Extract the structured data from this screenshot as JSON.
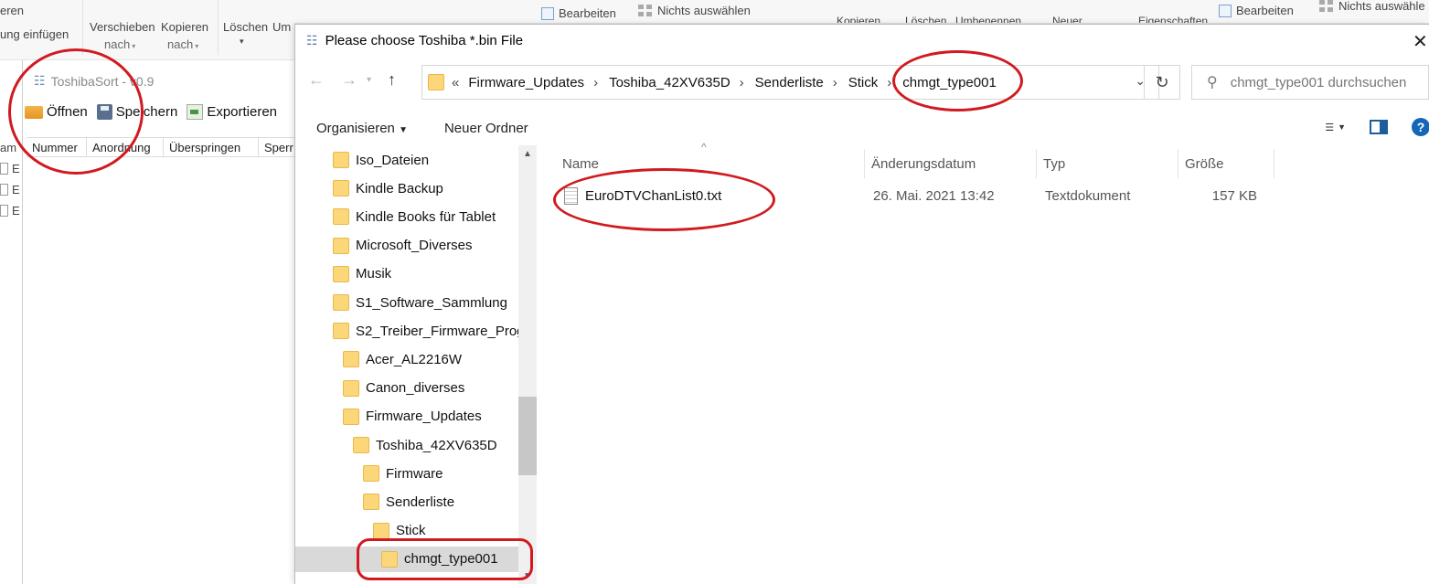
{
  "background_left": {
    "ribbon_texts": [
      "eren",
      "ung einfügen",
      "Verschieben",
      "nach",
      "Kopieren",
      "nach",
      "Löschen",
      "Um"
    ]
  },
  "background_right": {
    "ribbon_texts": [
      "Kopieren",
      "Löschen",
      "Umbenennen",
      "Neuer",
      "Eigenschaften",
      "Bearbeiten",
      "Nichts auswähle"
    ],
    "middle_texts": [
      "Bearbeiten",
      "Nichts auswählen"
    ]
  },
  "app": {
    "title": "ToshibaSort - v0.9",
    "toolbar": {
      "open": "Öffnen",
      "save": "Speichern",
      "export": "Exportieren"
    },
    "columns": [
      "Nummer",
      "Anordnung",
      "Überspringen",
      "Sperr"
    ],
    "left_stub": [
      "am",
      "E",
      "E",
      "E"
    ]
  },
  "dialog": {
    "title": "Please choose Toshiba *.bin File",
    "close": "✕",
    "breadcrumb": [
      "«",
      "Firmware_Updates",
      "Toshiba_42XV635D",
      "Senderliste",
      "Stick",
      "chmgt_type001"
    ],
    "search_placeholder": "chmgt_type001 durchsuchen",
    "commands": {
      "organize": "Organisieren",
      "new_folder": "Neuer Ordner"
    },
    "tree": [
      {
        "label": "Iso_Dateien",
        "indent": 0
      },
      {
        "label": "Kindle Backup",
        "indent": 0
      },
      {
        "label": "Kindle Books für Tablet",
        "indent": 0
      },
      {
        "label": "Microsoft_Diverses",
        "indent": 0
      },
      {
        "label": "Musik",
        "indent": 0
      },
      {
        "label": "S1_Software_Sammlung",
        "indent": 0
      },
      {
        "label": "S2_Treiber_Firmware_Prog",
        "indent": 0
      },
      {
        "label": "Acer_AL2216W",
        "indent": 1
      },
      {
        "label": "Canon_diverses",
        "indent": 1
      },
      {
        "label": "Firmware_Updates",
        "indent": 1
      },
      {
        "label": "Toshiba_42XV635D",
        "indent": 2
      },
      {
        "label": "Firmware",
        "indent": 3
      },
      {
        "label": "Senderliste",
        "indent": 3
      },
      {
        "label": "Stick",
        "indent": 4
      },
      {
        "label": "chmgt_type001",
        "indent": 5,
        "selected": true
      }
    ],
    "columns": {
      "name": "Name",
      "date": "Änderungsdatum",
      "type": "Typ",
      "size": "Größe"
    },
    "files": [
      {
        "name": "EuroDTVChanList0.txt",
        "date": "26. Mai. 2021 13:42",
        "type": "Textdokument",
        "size": "157 KB"
      }
    ]
  },
  "colors": {
    "annotation": "#d11a1f",
    "folder": "#fbd77a",
    "selection": "#d9d9d9",
    "help": "#1567b5"
  }
}
